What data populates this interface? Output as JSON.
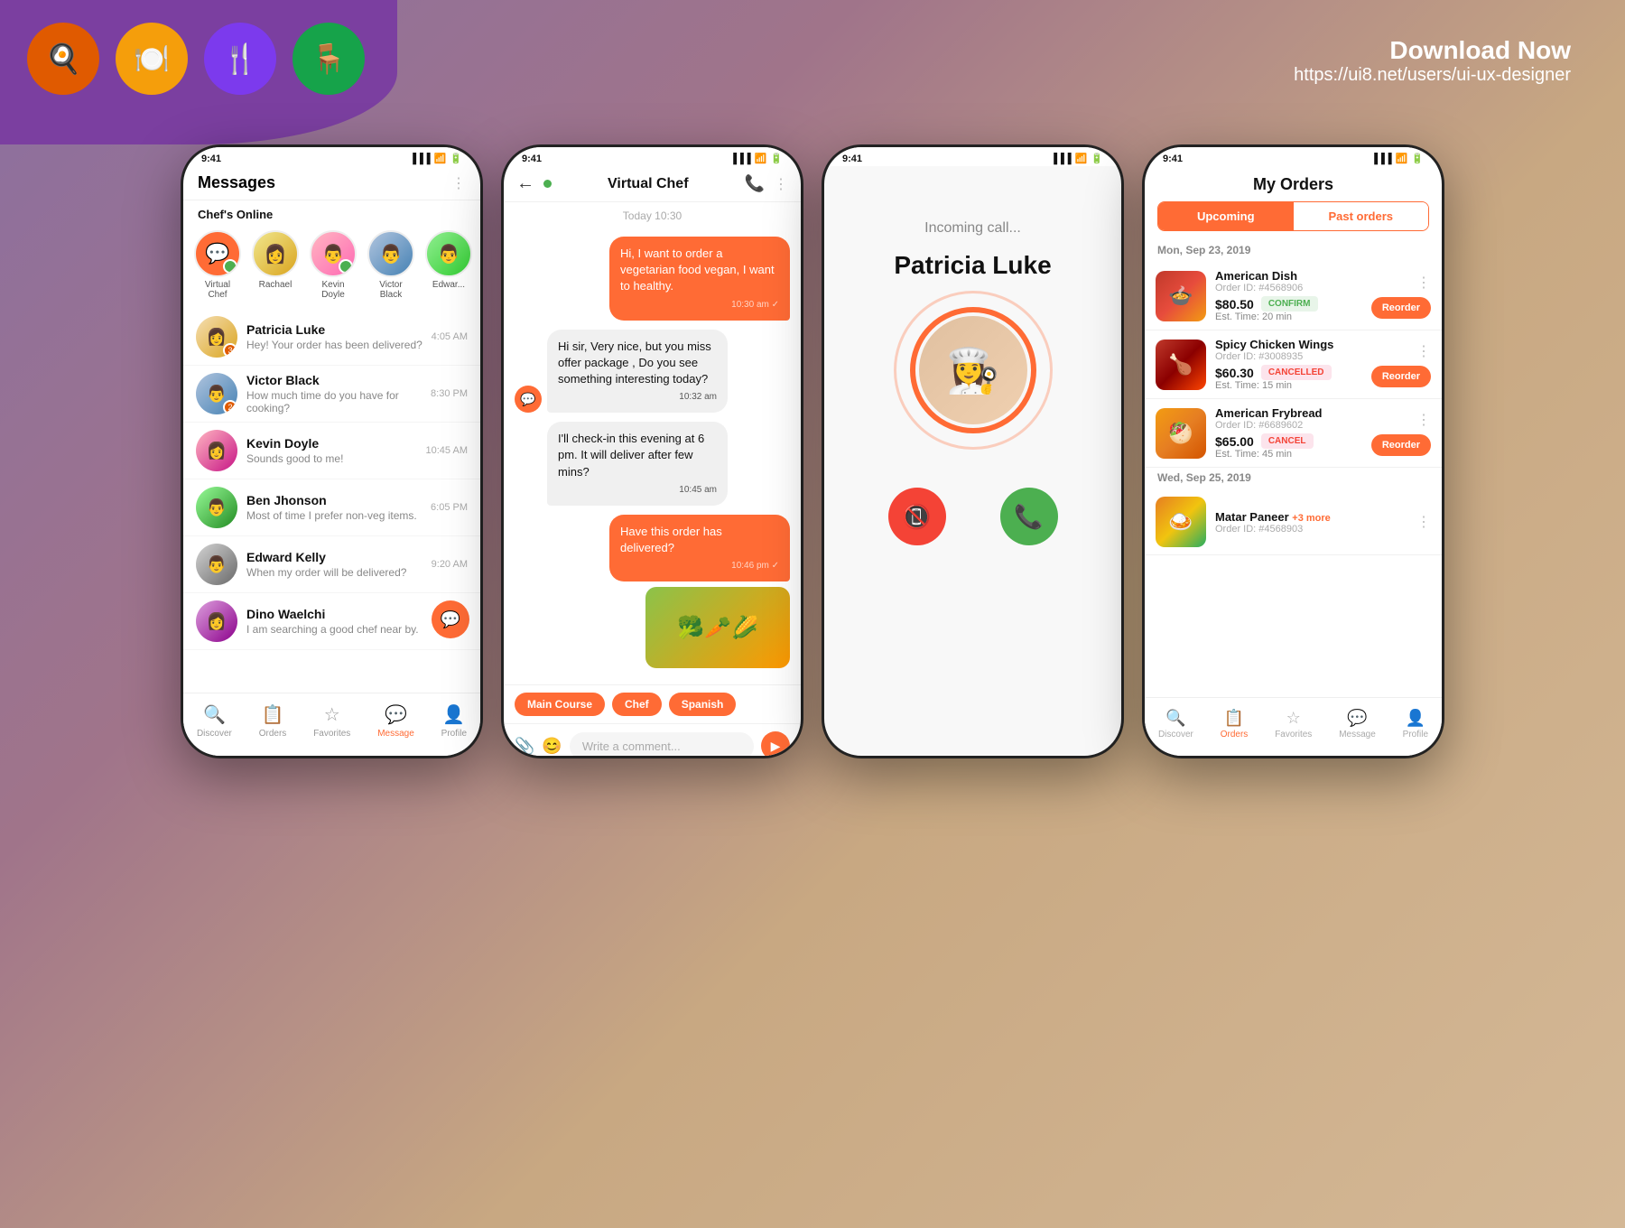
{
  "background": {
    "purple_blob_color": "#7b3fa0"
  },
  "header": {
    "download_title": "Download Now",
    "download_url": "https://ui8.net/users/ui-ux-designer"
  },
  "app_icons": [
    {
      "icon": "🍳",
      "color": "#e05a00",
      "label": "chef-hat"
    },
    {
      "icon": "🍽️",
      "color": "#f59e0b",
      "label": "plate"
    },
    {
      "icon": "🍴",
      "color": "#7c3aed",
      "label": "fork-cross"
    },
    {
      "icon": "🪑",
      "color": "#16a34a",
      "label": "chair"
    }
  ],
  "phone1": {
    "status_time": "9:41",
    "header_title": "Messages",
    "section_label": "Chef's Online",
    "chefs": [
      {
        "name": "Virtual Chef",
        "online": true
      },
      {
        "name": "Rachael",
        "online": false
      },
      {
        "name": "Kevin Doyle",
        "online": true
      },
      {
        "name": "Victor Black",
        "online": false
      },
      {
        "name": "Edwar...",
        "online": false
      }
    ],
    "messages": [
      {
        "name": "Patricia Luke",
        "preview": "Hey! Your order has been delivered?",
        "time": "4:05 AM",
        "badge": "3"
      },
      {
        "name": "Victor Black",
        "preview": "How much time do you have for cooking?",
        "time": "8:30 PM",
        "badge": "2"
      },
      {
        "name": "Kevin Doyle",
        "preview": "Sounds good to me!",
        "time": "10:45 AM",
        "badge": ""
      },
      {
        "name": "Ben Jhonson",
        "preview": "Most of time I prefer non-veg items.",
        "time": "6:05 PM",
        "badge": ""
      },
      {
        "name": "Edward Kelly",
        "preview": "When my order will be delivered?",
        "time": "9:20 AM",
        "badge": ""
      },
      {
        "name": "Dino Waelchi",
        "preview": "I am searching a good chef near by.",
        "time": "",
        "badge": ""
      }
    ],
    "nav": [
      {
        "label": "Discover",
        "icon": "🔍",
        "active": false
      },
      {
        "label": "Orders",
        "icon": "📋",
        "active": false
      },
      {
        "label": "Favorites",
        "icon": "⭐",
        "active": false
      },
      {
        "label": "Message",
        "icon": "💬",
        "active": true
      },
      {
        "label": "Profile",
        "icon": "👤",
        "active": false
      }
    ]
  },
  "phone2": {
    "status_time": "9:41",
    "contact_name": "Virtual Chef",
    "online": true,
    "chat_date": "Today 10:30",
    "messages": [
      {
        "type": "sent",
        "text": "Hi, I want to order a vegetarian food vegan, I want to healthy.",
        "time": "10:30 am"
      },
      {
        "type": "recv",
        "text": "Hi sir, Very nice, but you miss offer package , Do you see something interesting today?",
        "time": "10:32 am"
      },
      {
        "type": "recv",
        "text": "I'll check-in this evening at 6 pm. It will deliver after few mins?",
        "time": "10:45 am"
      },
      {
        "type": "sent",
        "text": "Have this order has delivered?",
        "time": "10:46 pm",
        "has_img": true
      }
    ],
    "tags": [
      "Main Course",
      "Chef",
      "Spanish"
    ],
    "input_placeholder": "Write a comment...",
    "input_placeholder_key": "chat_input_placeholder"
  },
  "phone3": {
    "status_time": "9:41",
    "incoming_label": "Incoming call...",
    "caller_name": "Patricia Luke",
    "decline_label": "decline",
    "accept_label": "accept"
  },
  "phone4": {
    "status_time": "9:41",
    "header_title": "My Orders",
    "tabs": [
      {
        "label": "Upcoming",
        "active": true
      },
      {
        "label": "Past orders",
        "active": false
      }
    ],
    "date1": "Mon, Sep 23, 2019",
    "date2": "Wed, Sep 25, 2019",
    "orders": [
      {
        "name": "American Dish",
        "order_id": "Order ID: #4568906",
        "price": "$80.50",
        "status": "CONFIRM",
        "status_type": "confirm",
        "est": "Est. Time: 20 min",
        "has_reorder": true
      },
      {
        "name": "Spicy Chicken Wings",
        "order_id": "Order ID: #3008935",
        "price": "$60.30",
        "status": "CANCELLED",
        "status_type": "cancelled",
        "est": "Est. Time: 15 min",
        "has_reorder": true
      },
      {
        "name": "American Frybread",
        "order_id": "Order ID: #6689602",
        "price": "$65.00",
        "status": "CANCEL",
        "status_type": "cancel",
        "est": "Est. Time: 45 min",
        "has_reorder": true
      },
      {
        "name": "Matar Paneer",
        "order_id": "+3 more",
        "price": "",
        "status": "",
        "status_type": "",
        "est": "",
        "has_reorder": false
      }
    ],
    "nav": [
      {
        "label": "Discover",
        "icon": "🔍",
        "active": false
      },
      {
        "label": "Orders",
        "icon": "📋",
        "active": true
      },
      {
        "label": "Favorites",
        "icon": "⭐",
        "active": false
      },
      {
        "label": "Message",
        "icon": "💬",
        "active": false
      },
      {
        "label": "Profile",
        "icon": "👤",
        "active": false
      }
    ]
  }
}
